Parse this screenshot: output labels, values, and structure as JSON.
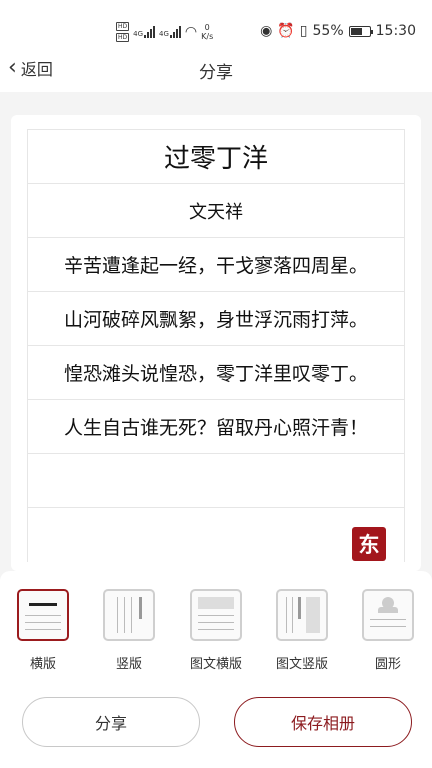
{
  "status_bar": {
    "network_speed_value": "0",
    "network_speed_unit": "K/s",
    "battery": "55%",
    "time": "15:30",
    "hd_label": "HD",
    "signal_label": "4G",
    "icons": [
      "hd-icon",
      "signal-icon",
      "wifi-icon",
      "eye-icon",
      "alarm-icon",
      "vibrate-icon",
      "battery-icon"
    ]
  },
  "nav": {
    "back_label": "返回",
    "title": "分享"
  },
  "poem": {
    "title": "过零丁洋",
    "author": "文天祥",
    "lines": [
      "辛苦遭逢起一经，干戈寥落四周星。",
      "山河破碎风飘絮，身世浮沉雨打萍。",
      "惶恐滩头说惶恐，零丁洋里叹零丁。",
      "人生自古谁无死？留取丹心照汗青！"
    ],
    "seal_char": "东"
  },
  "layout_options": [
    {
      "label": "横版",
      "active": true
    },
    {
      "label": "竖版",
      "active": false
    },
    {
      "label": "图文横版",
      "active": false
    },
    {
      "label": "图文竖版",
      "active": false
    },
    {
      "label": "圆形",
      "active": false
    }
  ],
  "actions": {
    "share_label": "分享",
    "save_label": "保存相册"
  },
  "colors": {
    "accent": "#9b1b1e",
    "seal": "#a3161c"
  }
}
